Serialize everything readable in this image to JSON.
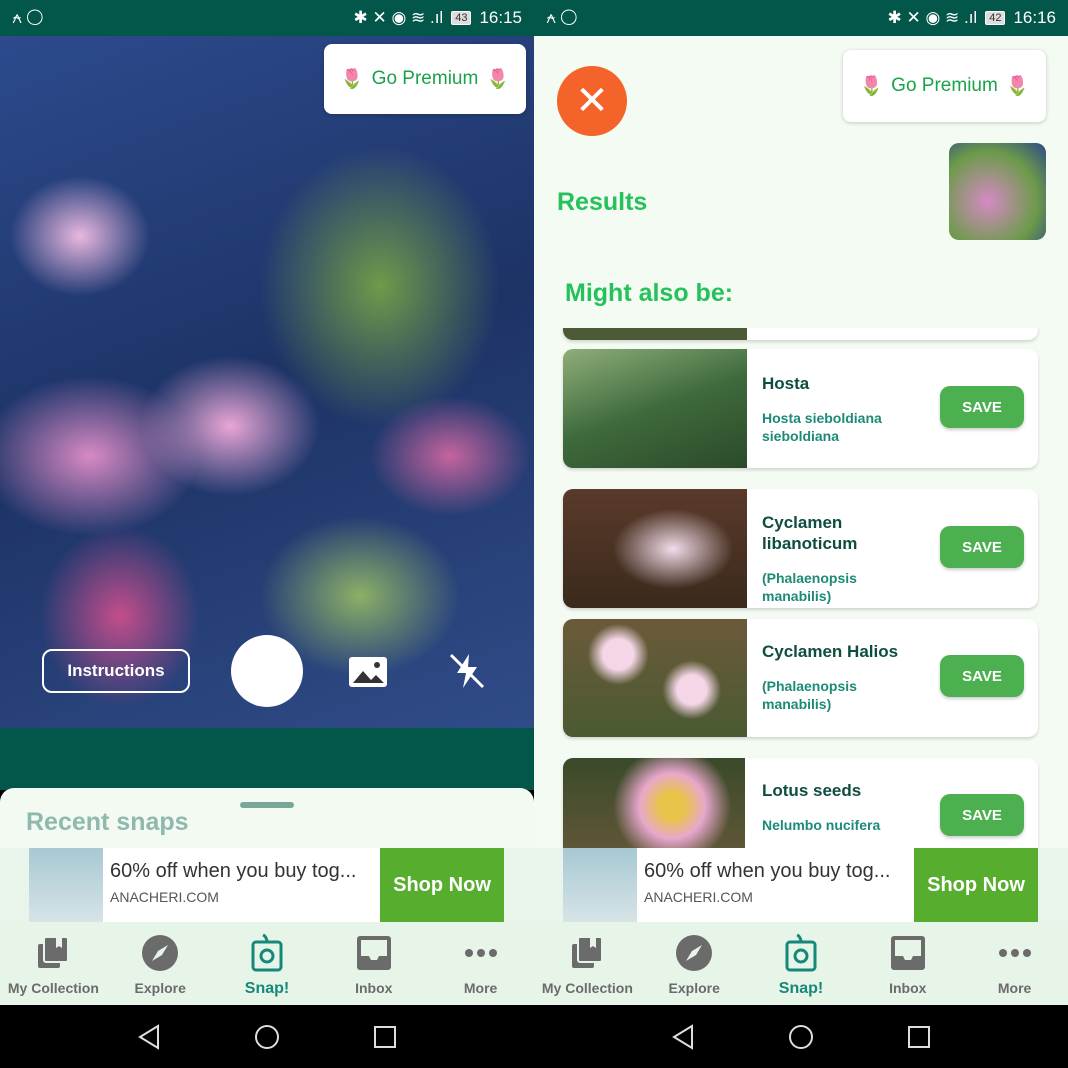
{
  "left": {
    "status": {
      "time": "16:15",
      "battery": "43"
    },
    "premium": "Go Premium",
    "instructions": "Instructions",
    "recent_snaps": "Recent snaps"
  },
  "right": {
    "status": {
      "time": "16:16",
      "battery": "42"
    },
    "premium": "Go Premium",
    "results": "Results",
    "might_also_be": "Might also be:",
    "cards": [
      {
        "name": "Hosta",
        "scientific": "Hosta sieboldiana sieboldiana",
        "save": "SAVE"
      },
      {
        "name": "Cyclamen libanoticum",
        "scientific": "(Phalaenopsis manabilis)",
        "save": "SAVE"
      },
      {
        "name": "Cyclamen Halios",
        "scientific": "(Phalaenopsis manabilis)",
        "save": "SAVE"
      },
      {
        "name": "Lotus seeds",
        "scientific": "Nelumbo nucifera",
        "save": "SAVE"
      }
    ]
  },
  "ad": {
    "title": "60% off when you buy tog...",
    "domain": "ANACHERI.COM",
    "cta": "Shop Now"
  },
  "nav": [
    {
      "label": "My Collection",
      "icon": "collection-icon"
    },
    {
      "label": "Explore",
      "icon": "compass-icon"
    },
    {
      "label": "Snap!",
      "icon": "snap-camera-icon",
      "active": true
    },
    {
      "label": "Inbox",
      "icon": "inbox-icon"
    },
    {
      "label": "More",
      "icon": "more-dots-icon"
    }
  ],
  "colors": {
    "status_bar": "#03574a",
    "accent": "#25c15a",
    "save": "#4caf50",
    "close": "#f4632a",
    "shop": "#57ad2e"
  }
}
